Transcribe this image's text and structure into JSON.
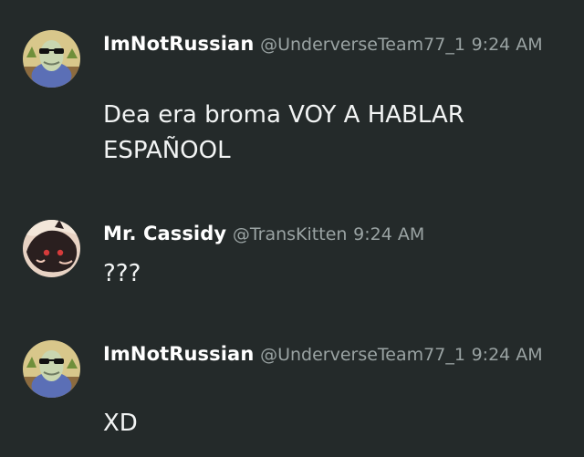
{
  "messages": [
    {
      "author": "ImNotRussian",
      "handle": "@UnderverseTeam77_1",
      "time": "9:24 AM",
      "text": "Dea era broma VOY A HABLAR ESPAÑOOL",
      "avatar_icon": "sunglasses-character-avatar"
    },
    {
      "author": "Mr. Cassidy",
      "handle": "@TransKitten",
      "time": "9:24 AM",
      "text": "???",
      "avatar_icon": "dark-creature-avatar"
    },
    {
      "author": "ImNotRussian",
      "handle": "@UnderverseTeam77_1",
      "time": "9:24 AM",
      "text": "XD",
      "avatar_icon": "sunglasses-character-avatar"
    }
  ],
  "colors": {
    "background": "#242a2a",
    "author": "#ffffff",
    "meta": "#9aa3a3",
    "text": "#f2f4f4"
  }
}
